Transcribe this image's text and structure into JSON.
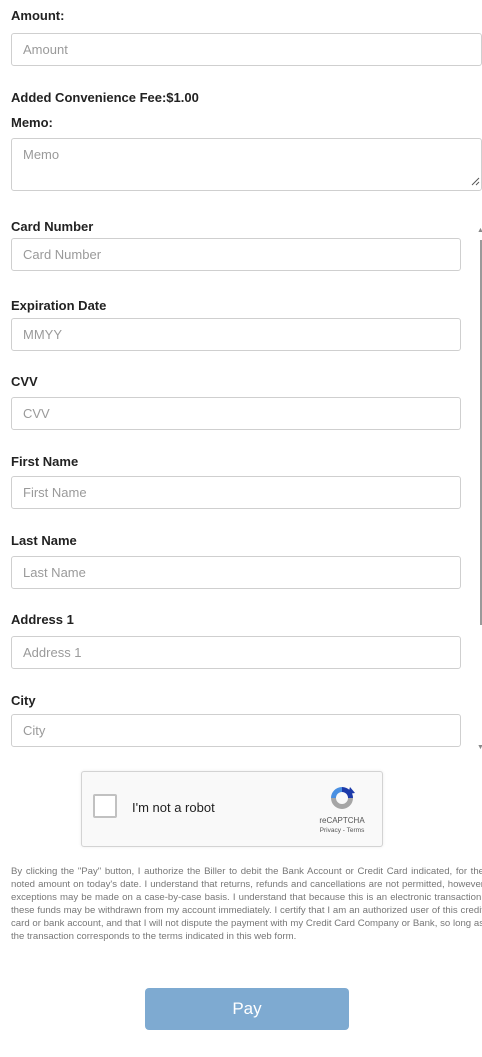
{
  "form": {
    "amount": {
      "label": "Amount:",
      "placeholder": "Amount",
      "value": ""
    },
    "fee_text": "Added Convenience Fee:$1.00",
    "memo": {
      "label": "Memo:",
      "placeholder": "Memo",
      "value": ""
    },
    "card_number": {
      "label": "Card Number",
      "placeholder": "Card Number",
      "value": ""
    },
    "expiration": {
      "label": "Expiration Date",
      "placeholder": "MMYY",
      "value": ""
    },
    "cvv": {
      "label": "CVV",
      "placeholder": "CVV",
      "value": ""
    },
    "first_name": {
      "label": "First Name",
      "placeholder": "First Name",
      "value": ""
    },
    "last_name": {
      "label": "Last Name",
      "placeholder": "Last Name",
      "value": ""
    },
    "address1": {
      "label": "Address 1",
      "placeholder": "Address 1",
      "value": ""
    },
    "city": {
      "label": "City",
      "placeholder": "City",
      "value": ""
    }
  },
  "recaptcha": {
    "checkbox_label": "I'm not a robot",
    "brand": "reCAPTCHA",
    "privacy_link": "Privacy",
    "separator": " - ",
    "terms_link": "Terms"
  },
  "disclaimer": "By clicking the \"Pay\" button, I authorize the Biller to debit the Bank Account or Credit Card indicated, for the noted amount on today's date. I understand that returns, refunds and cancellations are not permitted, however exceptions may be made on a case-by-case basis. I understand that because this is an electronic transaction, these funds may be withdrawn from my account immediately. I certify that I am an authorized user of this credit card or bank account, and that I will not dispute the payment with my Credit Card Company or Bank, so long as the transaction corresponds to the terms indicated in this web form.",
  "pay_button": {
    "label": "Pay"
  },
  "colors": {
    "pay_button_bg": "#7eaad1",
    "input_border": "#cfcfcf",
    "label_text": "#222222",
    "disclaimer_text": "#777777"
  },
  "icons": {
    "recaptcha_logo": "recaptcha-logo-icon",
    "resize_grip": "resize-grip-icon",
    "scroll_up": "scroll-up-arrow-icon",
    "scroll_down": "scroll-down-arrow-icon"
  }
}
